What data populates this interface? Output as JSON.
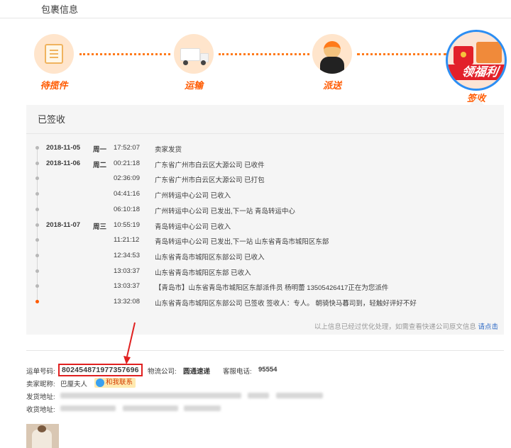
{
  "header": {
    "title": "包裹信息"
  },
  "progress": {
    "steps": [
      {
        "label": "待揽件",
        "icon": "package-icon"
      },
      {
        "label": "运输",
        "icon": "truck-icon"
      },
      {
        "label": "派送",
        "icon": "courier-icon"
      },
      {
        "label": "签收",
        "icon": "promo-icon"
      }
    ],
    "promo_text": "领福利",
    "accent": "#ff5a00"
  },
  "tracking": {
    "status_title": "已签收",
    "rows": [
      {
        "date": "2018-11-05",
        "weekday": "周一",
        "time": "17:52:07",
        "event": "卖家发货"
      },
      {
        "date": "2018-11-06",
        "weekday": "周二",
        "time": "00:21:18",
        "event": "广东省广州市白云区大源公司 已收件"
      },
      {
        "date": "",
        "weekday": "",
        "time": "02:36:09",
        "event": "广东省广州市白云区大源公司 已打包"
      },
      {
        "date": "",
        "weekday": "",
        "time": "04:41:16",
        "event": "广州转运中心公司 已收入"
      },
      {
        "date": "",
        "weekday": "",
        "time": "06:10:18",
        "event": "广州转运中心公司 已发出,下一站 青岛转运中心"
      },
      {
        "date": "2018-11-07",
        "weekday": "周三",
        "time": "10:55:19",
        "event": "青岛转运中心公司 已收入"
      },
      {
        "date": "",
        "weekday": "",
        "time": "11:21:12",
        "event": "青岛转运中心公司 已发出,下一站 山东省青岛市城阳区东部"
      },
      {
        "date": "",
        "weekday": "",
        "time": "12:34:53",
        "event": "山东省青岛市城阳区东部公司 已收入"
      },
      {
        "date": "",
        "weekday": "",
        "time": "13:03:37",
        "event": "山东省青岛市城阳区东部 已收入"
      },
      {
        "date": "",
        "weekday": "",
        "time": "13:03:37",
        "event": "【青岛市】山东省青岛市城阳区东部派件员 杨明蕾 13505426417正在为您派件"
      },
      {
        "date": "",
        "weekday": "",
        "time": "13:32:08",
        "event": "山东省青岛市城阳区东部公司 已签收 签收人：专人。 朝骑快马暮司到，轻触好评好不好"
      }
    ],
    "note": "以上信息已经过优化处理，如需查看快递公司原文信息 ",
    "note_link": "请点击"
  },
  "info": {
    "waybill_label": "运单号码:",
    "waybill_number": "802454871977357696",
    "carrier_label": "物流公司:",
    "carrier_name": "圆通速递",
    "phone_label": "客服电话:",
    "phone": "95554",
    "seller_label": "卖家昵称:",
    "seller_name": "巴厘夫人",
    "contact_label": "和我联系",
    "ship_from_label": "发货地址:",
    "ship_to_label": "收货地址:"
  }
}
